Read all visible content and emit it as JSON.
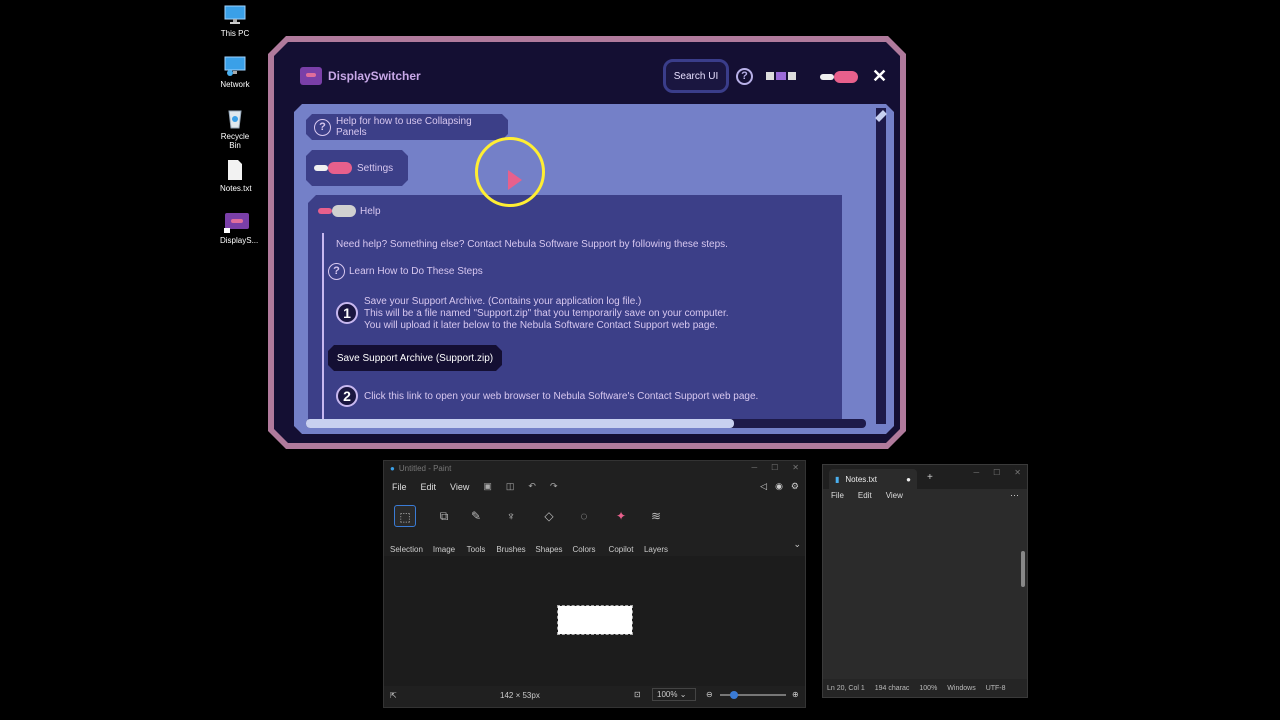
{
  "desktop": {
    "icons": [
      {
        "label": "This PC",
        "icon": "monitor-icon"
      },
      {
        "label": "Network",
        "icon": "network-icon"
      },
      {
        "label": "Recycle Bin",
        "icon": "recycle-bin-icon"
      },
      {
        "label": "Notes.txt",
        "icon": "text-file-icon"
      },
      {
        "label": "DisplayS...",
        "icon": "displayswitcher-shortcut-icon"
      }
    ]
  },
  "displayswitcher": {
    "title": "DisplaySwitcher",
    "search_label": "Search UI",
    "help_symbol": "?",
    "close_symbol": "✕",
    "collapse_help": "Help for how to use Collapsing Panels",
    "settings_label": "Settings",
    "help_label": "Help",
    "intro": "Need help?  Something else?  Contact Nebula Software Support by following these steps.",
    "learn_label": "Learn How to Do These Steps",
    "step1_num": "1",
    "step1_line1": "Save your Support Archive.  (Contains your application log file.)",
    "step1_line2": "This will be a file named \"Support.zip\" that you temporarily save on your computer.",
    "step1_line3": "You will upload it later below to the Nebula Software Contact Support web page.",
    "save_button": "Save Support Archive (Support.zip)",
    "step2_num": "2",
    "step2_text": "Click this link to open your web browser to Nebula Software's Contact Support web page.",
    "colors": {
      "frame": "#b07a9c",
      "background": "#140f33",
      "panel": "#3c3f88",
      "content": "#7480c8",
      "accent": "#e8608c"
    }
  },
  "paint": {
    "title": "Untitled - Paint",
    "menu": [
      "File",
      "Edit",
      "View"
    ],
    "tools": [
      "Selection",
      "Image",
      "Tools",
      "Brushes",
      "Shapes",
      "Colors",
      "Copilot",
      "Layers"
    ],
    "canvas_size": "142 × 53px",
    "zoom": "100%"
  },
  "notepad": {
    "tab_title": "Notes.txt",
    "menu": [
      "File",
      "Edit",
      "View"
    ],
    "status": {
      "position": "Ln 20, Col 1",
      "chars": "194 charac",
      "zoom": "100%",
      "line_ending": "Windows",
      "encoding": "UTF-8"
    }
  }
}
